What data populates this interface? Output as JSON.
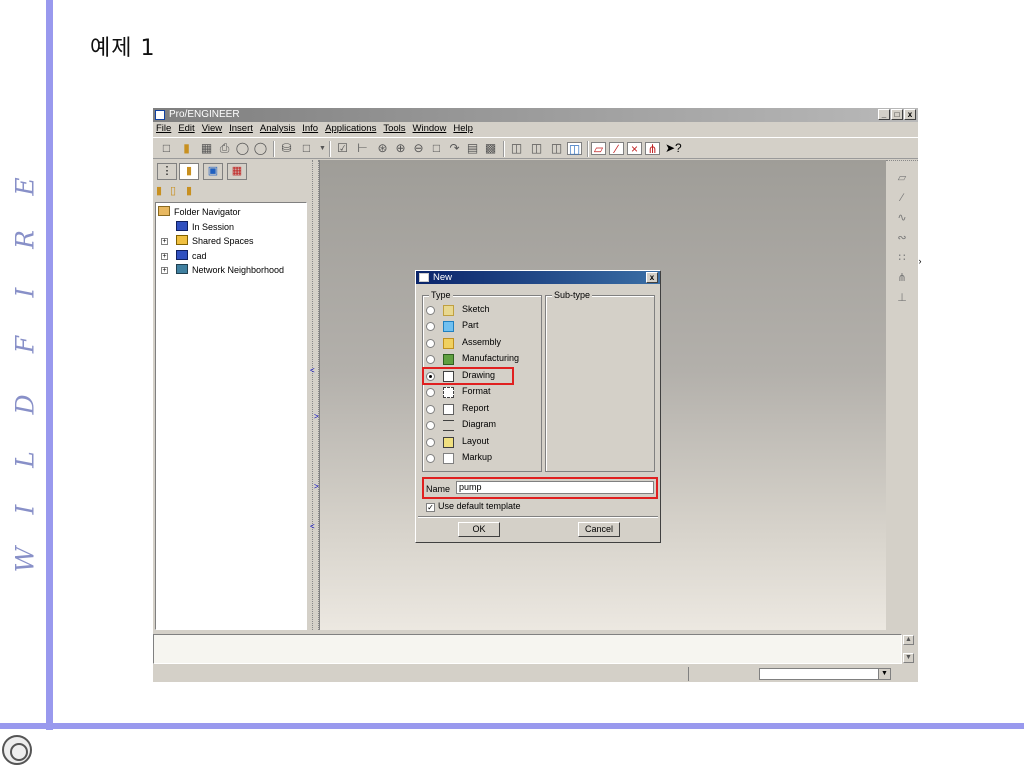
{
  "slide": {
    "title": "예제 1",
    "side_letters": [
      "E",
      "R",
      "I",
      "F",
      "D",
      "L",
      "I",
      "W"
    ]
  },
  "app": {
    "title": "Pro/ENGINEER",
    "window_buttons": [
      "_",
      "□",
      "x"
    ],
    "menu": [
      "File",
      "Edit",
      "View",
      "Insert",
      "Analysis",
      "Info",
      "Applications",
      "Tools",
      "Window",
      "Help"
    ],
    "toolbar_icons": [
      "new-icon",
      "open-icon",
      "save-icon",
      "print-icon",
      "send-icon",
      "email-icon",
      "find-icon",
      "select-icon",
      "regenerate-icon",
      "datum-icon",
      "zoom-in-icon",
      "zoom-out-icon",
      "refit-icon",
      "orient-icon",
      "saved-view-icon",
      "layers-icon",
      "wireframe-icon",
      "hidden-line-icon",
      "no-hidden-icon",
      "shaded-icon",
      "datum-plane-icon",
      "datum-axis-icon",
      "datum-point-icon",
      "coord-sys-icon",
      "whats-this-icon"
    ]
  },
  "navigator": {
    "tree": [
      {
        "label": "Folder Navigator",
        "icon": "folder-navigator-icon"
      },
      {
        "label": "In Session",
        "icon": "monitor-icon"
      },
      {
        "label": "Shared Spaces",
        "icon": "shared-spaces-icon"
      },
      {
        "label": "cad",
        "icon": "computer-icon"
      },
      {
        "label": "Network Neighborhood",
        "icon": "network-icon"
      }
    ]
  },
  "dialog": {
    "title": "New",
    "close": "x",
    "type_group": "Type",
    "subtype_group": "Sub-type",
    "types": [
      {
        "label": "Sketch",
        "icon": "sketch-icon",
        "selected": false
      },
      {
        "label": "Part",
        "icon": "part-icon",
        "selected": false
      },
      {
        "label": "Assembly",
        "icon": "assembly-icon",
        "selected": false
      },
      {
        "label": "Manufacturing",
        "icon": "manufacturing-icon",
        "selected": false
      },
      {
        "label": "Drawing",
        "icon": "drawing-icon",
        "selected": true
      },
      {
        "label": "Format",
        "icon": "format-icon",
        "selected": false
      },
      {
        "label": "Report",
        "icon": "report-icon",
        "selected": false
      },
      {
        "label": "Diagram",
        "icon": "diagram-icon",
        "selected": false
      },
      {
        "label": "Layout",
        "icon": "layout-icon",
        "selected": false
      },
      {
        "label": "Markup",
        "icon": "markup-icon",
        "selected": false
      }
    ],
    "name_label": "Name",
    "name_value": "pump",
    "use_template_label": "Use default template",
    "use_template_checked": true,
    "ok_label": "OK",
    "cancel_label": "Cancel"
  },
  "colors": {
    "accent_bar": "#9999ee",
    "highlight": "#e02020",
    "dialog_title": "#0a246a"
  }
}
